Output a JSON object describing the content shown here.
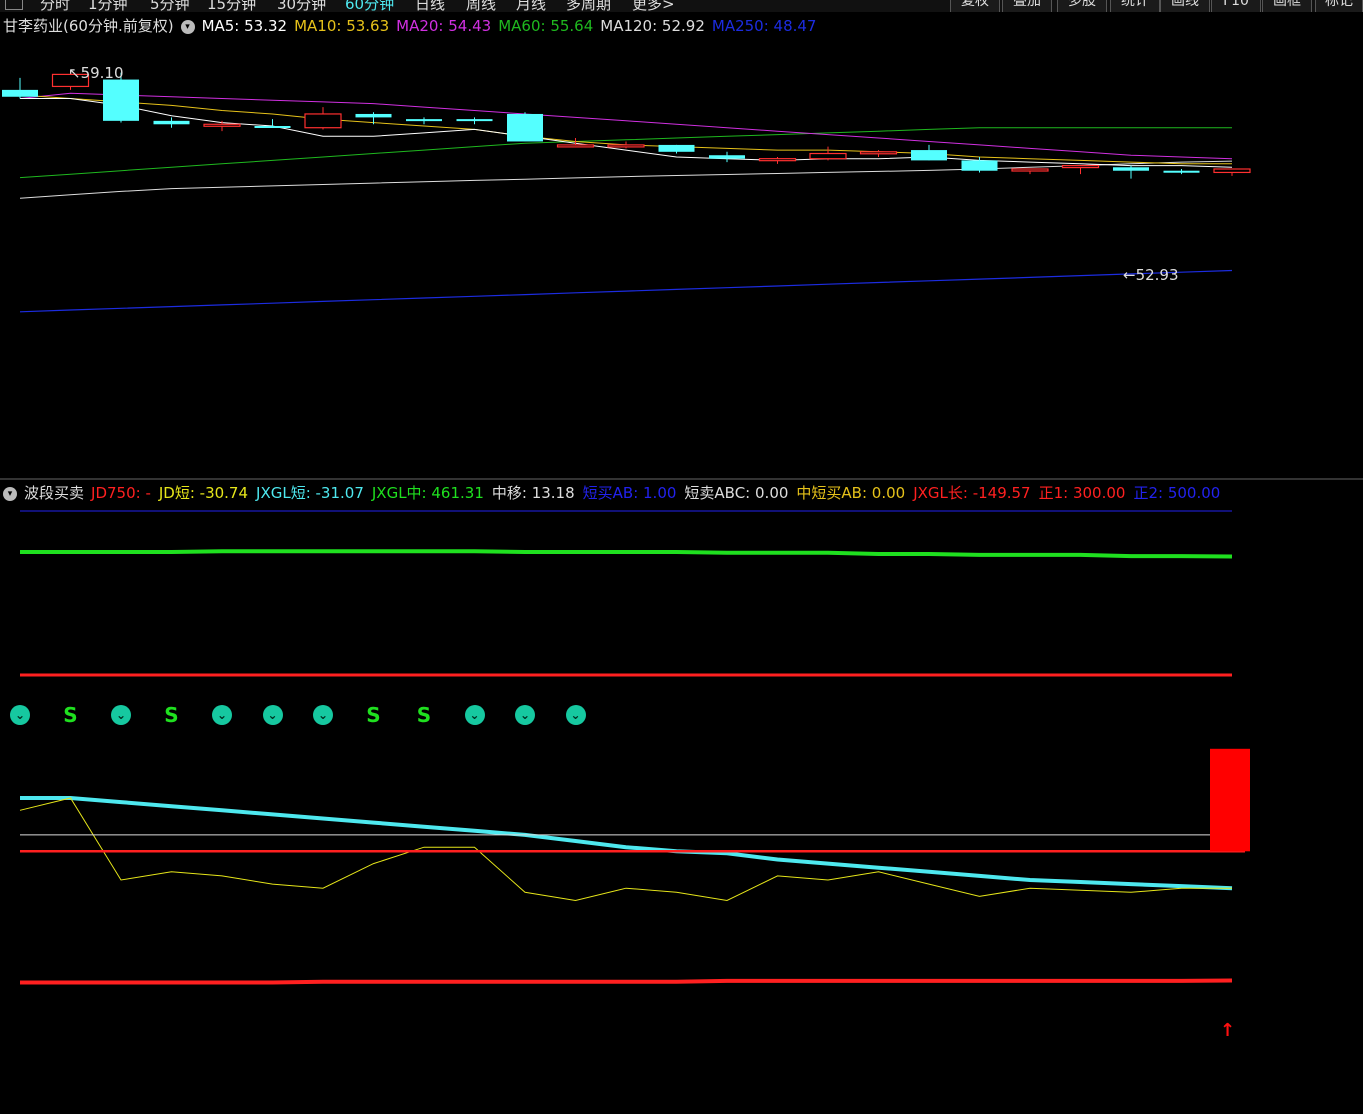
{
  "toolbar": {
    "left_tabs": [
      "分时",
      "1分钟",
      "5分钟",
      "15分钟",
      "30分钟",
      "60分钟",
      "日线",
      "周线",
      "月线",
      "多周期",
      "更多>"
    ],
    "active_tab": "60分钟",
    "right_buttons": [
      "复权",
      "叠加",
      "多股",
      "统计",
      "画线",
      "F10",
      "画框",
      "标记"
    ]
  },
  "main_panel": {
    "title": "甘李药业(60分钟.前复权)",
    "ma": [
      {
        "label": "MA5: 53.32",
        "color": "#ffffff"
      },
      {
        "label": "MA10: 53.63",
        "color": "#e6c21a"
      },
      {
        "label": "MA20: 54.43",
        "color": "#d030e0"
      },
      {
        "label": "MA60: 55.64",
        "color": "#1fb81f"
      },
      {
        "label": "MA120: 52.92",
        "color": "#dddddd"
      },
      {
        "label": "MA250: 48.47",
        "color": "#1c2ce0"
      }
    ],
    "high_label": "59.10",
    "low_label": "52.93"
  },
  "indicator_panel": {
    "title": "波段买卖",
    "items": [
      {
        "label": "JD750: -",
        "color": "#ff2020"
      },
      {
        "label": "JD短: -30.74",
        "color": "#e6e61a"
      },
      {
        "label": "JXGL短: -31.07",
        "color": "#4ee8ef"
      },
      {
        "label": "JXGL中: 461.31",
        "color": "#1fe01f"
      },
      {
        "label": "中移: 13.18",
        "color": "#dddddd"
      },
      {
        "label": "短买AB: 1.00",
        "color": "#2222ee"
      },
      {
        "label": "短卖ABC: 0.00",
        "color": "#dddddd"
      },
      {
        "label": "中短买AB: 0.00",
        "color": "#e6c21a"
      },
      {
        "label": "JXGL长: -149.57",
        "color": "#ff2020"
      },
      {
        "label": "正1: 300.00",
        "color": "#ff2020"
      },
      {
        "label": "正2: 500.00",
        "color": "#2222ee"
      }
    ],
    "signals": [
      "down",
      "S",
      "down",
      "S",
      "down",
      "down",
      "down",
      "S",
      "S",
      "down",
      "down",
      "down"
    ],
    "signal_text": "S"
  },
  "chart_data": [
    {
      "type": "candlestick",
      "title": "甘李药业(60分钟.前复权)",
      "y_range": [
        47.5,
        60.0
      ],
      "candles": [
        {
          "o": 58.55,
          "h": 58.9,
          "l": 58.3,
          "c": 58.35
        },
        {
          "o": 58.65,
          "h": 59.1,
          "l": 58.55,
          "c": 59.0
        },
        {
          "o": 58.85,
          "h": 59.05,
          "l": 57.6,
          "c": 57.65
        },
        {
          "o": 57.65,
          "h": 57.75,
          "l": 57.45,
          "c": 57.55
        },
        {
          "o": 57.55,
          "h": 57.65,
          "l": 57.35,
          "c": 57.55
        },
        {
          "o": 57.5,
          "h": 57.7,
          "l": 57.45,
          "c": 57.45
        },
        {
          "o": 57.45,
          "h": 58.05,
          "l": 57.4,
          "c": 57.85
        },
        {
          "o": 57.85,
          "h": 57.9,
          "l": 57.55,
          "c": 57.75
        },
        {
          "o": 57.7,
          "h": 57.75,
          "l": 57.55,
          "c": 57.65
        },
        {
          "o": 57.7,
          "h": 57.75,
          "l": 57.55,
          "c": 57.65
        },
        {
          "o": 57.85,
          "h": 57.9,
          "l": 57.05,
          "c": 57.05
        },
        {
          "o": 56.95,
          "h": 57.15,
          "l": 56.9,
          "c": 56.95
        },
        {
          "o": 56.95,
          "h": 57.05,
          "l": 56.85,
          "c": 56.95
        },
        {
          "o": 56.95,
          "h": 56.95,
          "l": 56.7,
          "c": 56.75
        },
        {
          "o": 56.65,
          "h": 56.75,
          "l": 56.45,
          "c": 56.55
        },
        {
          "o": 56.5,
          "h": 56.6,
          "l": 56.4,
          "c": 56.55
        },
        {
          "o": 56.55,
          "h": 56.9,
          "l": 56.5,
          "c": 56.7
        },
        {
          "o": 56.7,
          "h": 56.8,
          "l": 56.6,
          "c": 56.75
        },
        {
          "o": 56.8,
          "h": 56.95,
          "l": 56.5,
          "c": 56.5
        },
        {
          "o": 56.5,
          "h": 56.6,
          "l": 56.15,
          "c": 56.2
        },
        {
          "o": 56.2,
          "h": 56.25,
          "l": 56.1,
          "c": 56.25
        },
        {
          "o": 56.3,
          "h": 56.35,
          "l": 56.1,
          "c": 56.35
        },
        {
          "o": 56.3,
          "h": 56.35,
          "l": 55.97,
          "c": 56.2
        },
        {
          "o": 56.2,
          "h": 56.25,
          "l": 56.1,
          "c": 56.15
        },
        {
          "o": 56.15,
          "h": 56.25,
          "l": 56.05,
          "c": 56.25
        }
      ],
      "ma5": [
        58.3,
        58.3,
        58.1,
        57.8,
        57.6,
        57.5,
        57.2,
        57.2,
        57.3,
        57.4,
        57.2,
        57.0,
        56.8,
        56.6,
        56.55,
        56.5,
        56.55,
        56.55,
        56.6,
        56.5,
        56.45,
        56.4,
        56.35,
        56.35,
        56.3
      ],
      "ma10": [
        58.4,
        58.3,
        58.2,
        58.1,
        57.95,
        57.85,
        57.7,
        57.6,
        57.5,
        57.4,
        57.2,
        57.05,
        56.95,
        56.9,
        56.85,
        56.8,
        56.8,
        56.75,
        56.7,
        56.6,
        56.55,
        56.5,
        56.45,
        56.4,
        56.4
      ],
      "ma20": [
        58.3,
        58.45,
        58.4,
        58.35,
        58.3,
        58.25,
        58.2,
        58.15,
        58.05,
        57.95,
        57.85,
        57.75,
        57.65,
        57.55,
        57.45,
        57.35,
        57.25,
        57.15,
        57.05,
        56.95,
        56.85,
        56.75,
        56.65,
        56.6,
        56.55
      ],
      "ma60": [
        56.0,
        56.1,
        56.2,
        56.3,
        56.4,
        56.5,
        56.6,
        56.7,
        56.8,
        56.9,
        57.0,
        57.05,
        57.1,
        57.15,
        57.2,
        57.25,
        57.3,
        57.35,
        57.4,
        57.45,
        57.45,
        57.45,
        57.45,
        57.45,
        57.45
      ],
      "ma120": [
        55.4,
        55.5,
        55.6,
        55.68,
        55.72,
        55.76,
        55.8,
        55.84,
        55.88,
        55.92,
        55.95,
        55.99,
        56.03,
        56.06,
        56.09,
        56.12,
        56.15,
        56.18,
        56.21,
        56.25,
        56.3,
        56.35,
        56.4,
        56.45,
        56.48
      ],
      "ma250": [
        52.1,
        52.15,
        52.2,
        52.25,
        52.3,
        52.35,
        52.4,
        52.45,
        52.5,
        52.55,
        52.6,
        52.65,
        52.7,
        52.75,
        52.8,
        52.85,
        52.9,
        52.95,
        53.0,
        53.05,
        53.1,
        53.15,
        53.2,
        53.25,
        53.3
      ]
    },
    {
      "type": "line",
      "title": "波段买卖",
      "y_range": [
        -400,
        1100
      ],
      "series": [
        {
          "name": "JXGL中",
          "color": "#1fe01f",
          "values": [
            900,
            900,
            900,
            900,
            902,
            902,
            902,
            902,
            902,
            902,
            900,
            900,
            900,
            900,
            898,
            898,
            898,
            895,
            895,
            893,
            893,
            893,
            890,
            890,
            889
          ]
        },
        {
          "name": "正2",
          "color": "#2222ee",
          "values": [
            1000,
            1000,
            1000,
            1000,
            1000,
            1000,
            1000,
            1000,
            1000,
            1000,
            1000,
            1000,
            1000,
            1000,
            1000,
            1000,
            1000,
            1000,
            1000,
            1000,
            1000,
            1000,
            1000,
            1000,
            1000
          ]
        },
        {
          "name": "正1",
          "color": "#ff2020",
          "values": [
            600,
            600,
            600,
            600,
            600,
            600,
            600,
            600,
            600,
            600,
            600,
            600,
            600,
            600,
            600,
            600,
            600,
            600,
            600,
            600,
            600,
            600,
            600,
            600,
            600
          ]
        },
        {
          "name": "JXGL短",
          "color": "#4ee8ef",
          "values": [
            300,
            300,
            290,
            280,
            270,
            260,
            250,
            240,
            230,
            220,
            210,
            195,
            180,
            170,
            165,
            150,
            140,
            130,
            120,
            110,
            100,
            95,
            90,
            85,
            80
          ]
        },
        {
          "name": "JD短",
          "color": "#e6e61a",
          "values": [
            270,
            300,
            100,
            120,
            110,
            90,
            80,
            140,
            180,
            180,
            70,
            50,
            80,
            70,
            50,
            110,
            100,
            120,
            90,
            60,
            80,
            75,
            70,
            80,
            80
          ]
        },
        {
          "name": "中移",
          "color": "#dddddd",
          "values": [
            210,
            210,
            210,
            210,
            210,
            210,
            210,
            210,
            210,
            210,
            210,
            210,
            210,
            210,
            210,
            210,
            210,
            210,
            210,
            210,
            210,
            210,
            210,
            210,
            210
          ]
        },
        {
          "name": "JXGL长",
          "color": "#ff2020",
          "values": [
            -150,
            -150,
            -150,
            -150,
            -150,
            -150,
            -148,
            -148,
            -148,
            -148,
            -148,
            -148,
            -148,
            -148,
            -146,
            -146,
            -146,
            -146,
            -146,
            -146,
            -146,
            -146,
            -146,
            -146,
            -145
          ]
        }
      ],
      "bars": [
        {
          "index": 24,
          "from": 170,
          "to": 420,
          "color": "#ff0000"
        }
      ]
    }
  ]
}
